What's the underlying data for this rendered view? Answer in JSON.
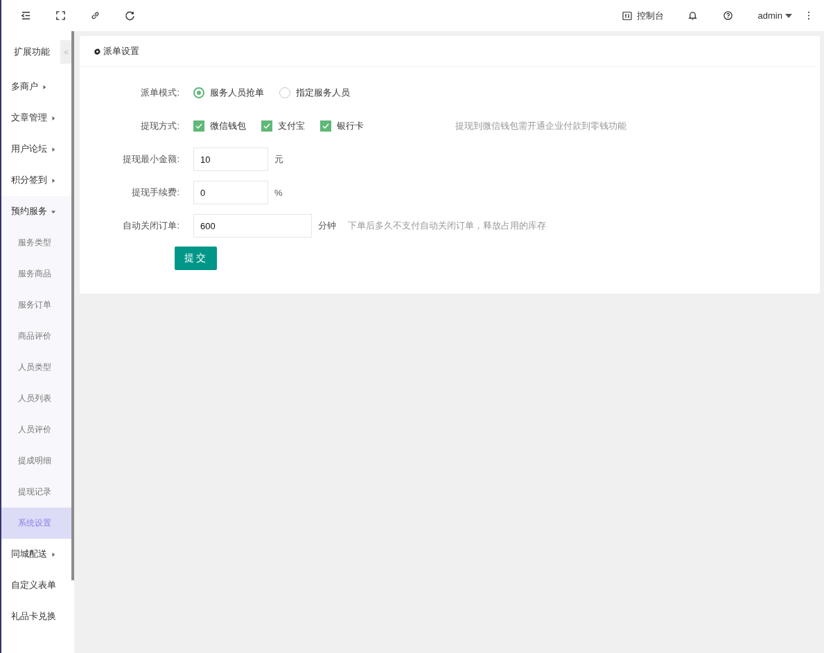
{
  "topbar": {
    "console_label": "控制台",
    "user": "admin"
  },
  "sidebar": {
    "title": "扩展功能",
    "items": [
      {
        "label": "多商户",
        "expanded": false,
        "selected": false
      },
      {
        "label": "文章管理",
        "expanded": false,
        "selected": false
      },
      {
        "label": "用户论坛",
        "expanded": false,
        "selected": false
      },
      {
        "label": "积分签到",
        "expanded": false,
        "selected": false
      },
      {
        "label": "预约服务",
        "expanded": true,
        "selected": false,
        "children": [
          {
            "label": "服务类型",
            "selected": false
          },
          {
            "label": "服务商品",
            "selected": false
          },
          {
            "label": "服务订单",
            "selected": false
          },
          {
            "label": "商品评价",
            "selected": false
          },
          {
            "label": "人员类型",
            "selected": false
          },
          {
            "label": "人员列表",
            "selected": false
          },
          {
            "label": "人员评价",
            "selected": false
          },
          {
            "label": "提成明细",
            "selected": false
          },
          {
            "label": "提现记录",
            "selected": false
          },
          {
            "label": "系统设置",
            "selected": true
          }
        ]
      },
      {
        "label": "同城配送",
        "expanded": false,
        "selected": false
      },
      {
        "label": "自定义表单",
        "selected": false
      },
      {
        "label": "礼品卡兑换",
        "selected": false
      }
    ]
  },
  "card": {
    "title": "派单设置",
    "rows": [
      {
        "kind": "radio",
        "label": "派单模式:",
        "options": [
          {
            "label": "服务人员抢单",
            "selected": true
          },
          {
            "label": "指定服务人员",
            "selected": false
          }
        ]
      },
      {
        "kind": "checkbox",
        "label": "提现方式:",
        "options": [
          {
            "label": "微信钱包",
            "checked": true
          },
          {
            "label": "支付宝",
            "checked": true
          },
          {
            "label": "银行卡",
            "checked": true
          }
        ],
        "hint": "提现到微信钱包需开通企业付款到零钱功能"
      },
      {
        "kind": "input",
        "label": "提现最小金额:",
        "value": "10",
        "unit": "元"
      },
      {
        "kind": "input",
        "label": "提现手续费:",
        "value": "0",
        "unit": "%"
      },
      {
        "kind": "input",
        "label": "自动关闭订单:",
        "value": "600",
        "unit": "分钟",
        "hint": "下单后多久不支付自动关闭订单，释放占用的库存"
      }
    ],
    "submit": "提交"
  }
}
